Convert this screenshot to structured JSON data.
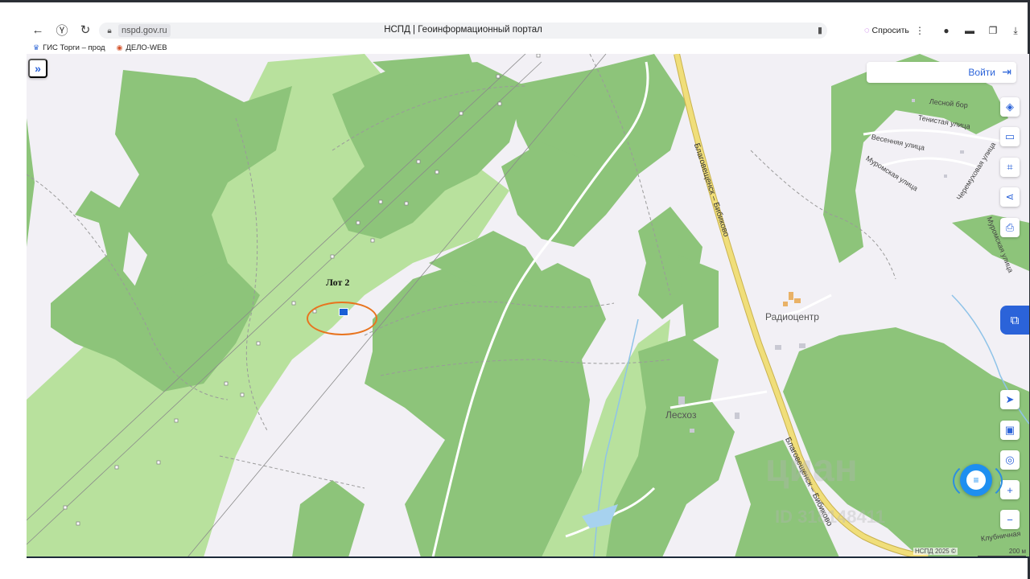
{
  "browser": {
    "host": "nspd.gov.ru",
    "page_title": "НСПД | Геоинформационный портал",
    "ask_label": "Спросить",
    "bookmarks": [
      {
        "label": "ГИС Торги – прод"
      },
      {
        "label": "ДЕЛО-WEB"
      }
    ]
  },
  "map": {
    "login_label": "Войти",
    "lot_label": "Лот 2",
    "places": {
      "radiocenter": "Радиоцентр",
      "leshoz": "Лесхоз"
    },
    "streets": {
      "lesnoy_bor": "Лесной бор",
      "tenistaya": "Тенистая улица",
      "vesennyaya": "Весенняя улица",
      "muromskaya": "Муромская улица",
      "cheremuhovaya": "Черемуховая улица",
      "murom2": "Муромская улица",
      "klubnichnaya": "Клубничная"
    },
    "road_label": "Благовещенск – Бибиково",
    "watermark": "циан",
    "watermark_id": "ID 318148411",
    "copyright": "НСПД 2025 ©",
    "scale_label": "200 м",
    "colors": {
      "forest": "#8dc47a",
      "meadow": "#b8e19d",
      "background": "#f2f0f5",
      "road": "#e9d36a",
      "accent": "#2b63d9",
      "lot_ring": "#e8741f"
    }
  }
}
